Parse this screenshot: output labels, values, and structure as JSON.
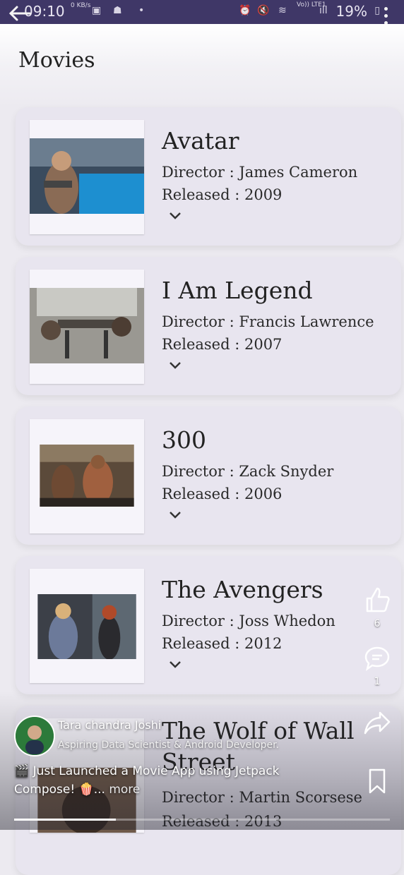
{
  "status_bar": {
    "time": "09:10",
    "battery": "19%",
    "net_speed": "0 KB/s",
    "network": "Vo)) LTE1"
  },
  "header": {
    "title": "Movies"
  },
  "movies": [
    {
      "title": "Avatar",
      "director": "Director : James Cameron",
      "released": "Released : 2009"
    },
    {
      "title": "I Am Legend",
      "director": "Director : Francis Lawrence",
      "released": "Released : 2007"
    },
    {
      "title": "300",
      "director": "Director : Zack Snyder",
      "released": "Released : 2006"
    },
    {
      "title": "The Avengers",
      "director": "Director : Joss Whedon",
      "released": "Released : 2012"
    },
    {
      "title": "The Wolf of Wall Street",
      "director": "Director : Martin Scorsese",
      "released": "Released : 2013"
    }
  ],
  "reel": {
    "author_name": "Tara chandra Joshi",
    "author_subtitle": "Aspiring Data Scientist & Android Developer.",
    "caption": "🎬 Just Launched a Movie App using Jetpack Compose! 🍿...",
    "more_label": "more",
    "likes": "6",
    "comments": "1",
    "progress": 0.27
  },
  "icons": {
    "back": "back-arrow-icon",
    "menu": "kebab-menu-icon",
    "like": "thumbs-up-icon",
    "comment": "comment-icon",
    "share": "share-icon",
    "save": "bookmark-icon",
    "expand": "chevron-down-icon"
  },
  "colors": {
    "status_bar": "#3f3767",
    "card": "#e8e5ef",
    "background": "#eceaf0"
  }
}
